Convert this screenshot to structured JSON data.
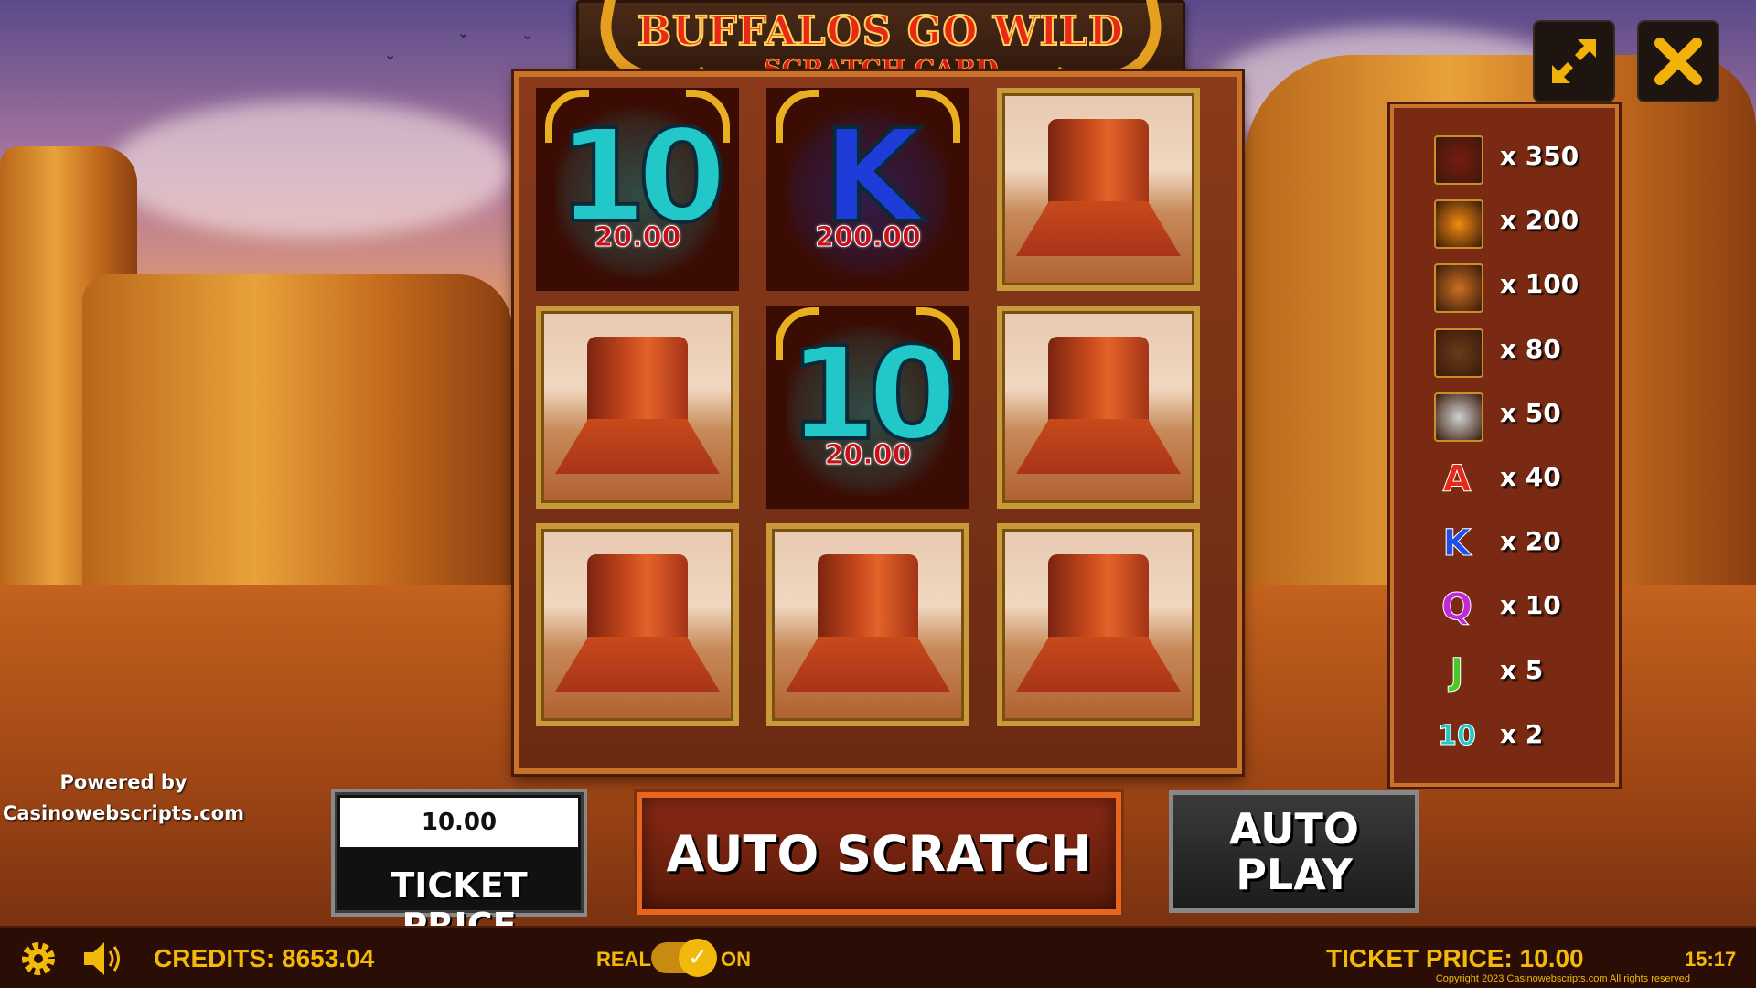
{
  "game": {
    "title": "BUFFALOS GO WILD",
    "subtitle": "SCRATCH CARD"
  },
  "grid": [
    {
      "state": "revealed",
      "symbol": "10",
      "value": "20.00",
      "color": "#22c8c8"
    },
    {
      "state": "revealed",
      "symbol": "K",
      "value": "200.00",
      "color": "#1e3cd8"
    },
    {
      "state": "covered"
    },
    {
      "state": "covered"
    },
    {
      "state": "revealed",
      "symbol": "10",
      "value": "20.00",
      "color": "#22c8c8"
    },
    {
      "state": "covered"
    },
    {
      "state": "covered"
    },
    {
      "state": "covered"
    },
    {
      "state": "covered"
    }
  ],
  "paytable": [
    {
      "icon": "buffalo-icon",
      "label": "x 350",
      "color": "#7a1a10"
    },
    {
      "icon": "sun-coin-icon",
      "label": "x 200",
      "color": "#f08a10"
    },
    {
      "icon": "eagle-icon",
      "label": "x 100",
      "color": "#c87020"
    },
    {
      "icon": "bear-icon",
      "label": "x 80",
      "color": "#6a3a1a"
    },
    {
      "icon": "wolf-icon",
      "label": "x 50",
      "color": "#d0d0d0"
    },
    {
      "icon": "letter-a-icon",
      "glyph": "A",
      "label": "x 40",
      "color": "#e82818"
    },
    {
      "icon": "letter-k-icon",
      "glyph": "K",
      "label": "x 20",
      "color": "#2050e8"
    },
    {
      "icon": "letter-q-icon",
      "glyph": "Q",
      "label": "x 10",
      "color": "#c028d8"
    },
    {
      "icon": "letter-j-icon",
      "glyph": "J",
      "label": "x 5",
      "color": "#4ac82a"
    },
    {
      "icon": "letter-10-icon",
      "glyph": "10",
      "label": "x 2",
      "color": "#22c8c8"
    }
  ],
  "controls": {
    "ticket_value": "10.00",
    "ticket_label": "TICKET PRICE",
    "auto_scratch": "AUTO SCRATCH",
    "auto_play_line1": "AUTO",
    "auto_play_line2": "PLAY"
  },
  "powered": {
    "line1": "Powered by",
    "line2": "Casinowebscripts.com"
  },
  "status": {
    "credits": "CREDITS: 8653.04",
    "mode_left": "REAL",
    "mode_right": "ON",
    "ticket_price": "TICKET PRICE: 10.00",
    "time": "15:17",
    "copyright": "Copyright 2023 Casinowebscripts.com All rights reserved"
  },
  "colors": {
    "accent": "#f2b80a",
    "board_border": "#c8722a"
  }
}
